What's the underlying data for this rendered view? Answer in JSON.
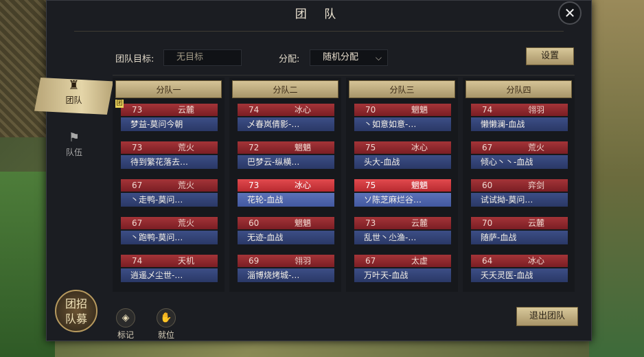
{
  "title": "团 队",
  "close_glyph": "✕",
  "team_goal": {
    "label": "团队目标:",
    "value": "无目标"
  },
  "distribution": {
    "label": "分配:",
    "value": "随机分配"
  },
  "settings_label": "设置",
  "exit_label": "退出团队",
  "sidebar": [
    {
      "label": "团队",
      "icon": "team-banner-icon",
      "active": true
    },
    {
      "label": "队伍",
      "icon": "squad-flag-icon",
      "active": false
    }
  ],
  "recruit": {
    "line1": "团招",
    "line2": "队募"
  },
  "bottom_buttons": [
    {
      "label": "标记",
      "icon": "mark-icon",
      "glyph": "◈"
    },
    {
      "label": "就位",
      "icon": "ready-icon",
      "glyph": "✋"
    }
  ],
  "leader_badge": "团",
  "squads": [
    {
      "name": "分队一",
      "members": [
        {
          "level": "73",
          "class": "云麓",
          "name": "梦益-莫问今朝",
          "highlight": false,
          "leader": true
        },
        {
          "level": "73",
          "class": "荒火",
          "name": "待到繁花落去…",
          "highlight": false
        },
        {
          "level": "67",
          "class": "荒火",
          "name": "丶走鸭-莫问…",
          "highlight": false
        },
        {
          "level": "67",
          "class": "荒火",
          "name": "丶跑鸭-莫问…",
          "highlight": false
        },
        {
          "level": "74",
          "class": "天机",
          "name": "逍遥乄尘世-…",
          "highlight": false
        }
      ]
    },
    {
      "name": "分队二",
      "members": [
        {
          "level": "74",
          "class": "冰心",
          "name": "乄春岚倩影-…",
          "highlight": false
        },
        {
          "level": "72",
          "class": "魍魉",
          "name": "巴梦云-纵横…",
          "highlight": false
        },
        {
          "level": "73",
          "class": "冰心",
          "name": "花轮-血战",
          "highlight": true
        },
        {
          "level": "60",
          "class": "魍魉",
          "name": "无迹-血战",
          "highlight": false
        },
        {
          "level": "69",
          "class": "翎羽",
          "name": "淄博烧烤城-…",
          "highlight": false
        }
      ]
    },
    {
      "name": "分队三",
      "members": [
        {
          "level": "70",
          "class": "魍魉",
          "name": "丶如意如意-…",
          "highlight": false
        },
        {
          "level": "75",
          "class": "冰心",
          "name": "头大-血战",
          "highlight": false
        },
        {
          "level": "75",
          "class": "魍魉",
          "name": "ソ陈芝麻烂谷…",
          "highlight": true
        },
        {
          "level": "73",
          "class": "云麓",
          "name": "乱世丶尐渔-…",
          "highlight": false
        },
        {
          "level": "67",
          "class": "太虚",
          "name": "万叶天-血战",
          "highlight": false
        }
      ]
    },
    {
      "name": "分队四",
      "members": [
        {
          "level": "74",
          "class": "翎羽",
          "name": "懒懒澜-血战",
          "highlight": false
        },
        {
          "level": "67",
          "class": "荒火",
          "name": "倾心丶丶-血战",
          "highlight": false
        },
        {
          "level": "60",
          "class": "弈剑",
          "name": "试试拗-莫问…",
          "highlight": false
        },
        {
          "level": "70",
          "class": "云麓",
          "name": "随萨-血战",
          "highlight": false
        },
        {
          "level": "64",
          "class": "冰心",
          "name": "夭夭灵医-血战",
          "highlight": false
        }
      ]
    }
  ]
}
